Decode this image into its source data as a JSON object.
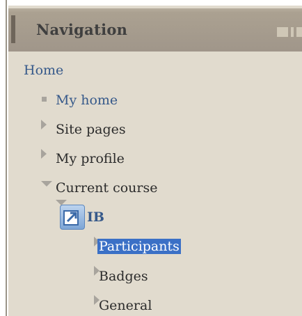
{
  "navigation": {
    "title": "Navigation",
    "home_label": "Home",
    "items": [
      {
        "label": "My home",
        "icon": "bullet-icon"
      },
      {
        "label": "Site pages",
        "icon": "expand-right-icon"
      },
      {
        "label": "My profile",
        "icon": "expand-right-icon"
      },
      {
        "label": "Current course",
        "icon": "expand-down-icon"
      }
    ],
    "course": {
      "label": "IB",
      "icon": "course-shortcut-icon",
      "children": [
        {
          "label": "Participants",
          "selected": true,
          "icon": "expand-right-icon"
        },
        {
          "label": "Badges",
          "icon": "expand-right-icon"
        },
        {
          "label": "General",
          "icon": "expand-right-icon"
        }
      ]
    }
  },
  "colors": {
    "panel_background": "#e1dbce",
    "header_background": "#a0968a",
    "link": "#36598a",
    "selected_highlight": "#3b70c6"
  }
}
